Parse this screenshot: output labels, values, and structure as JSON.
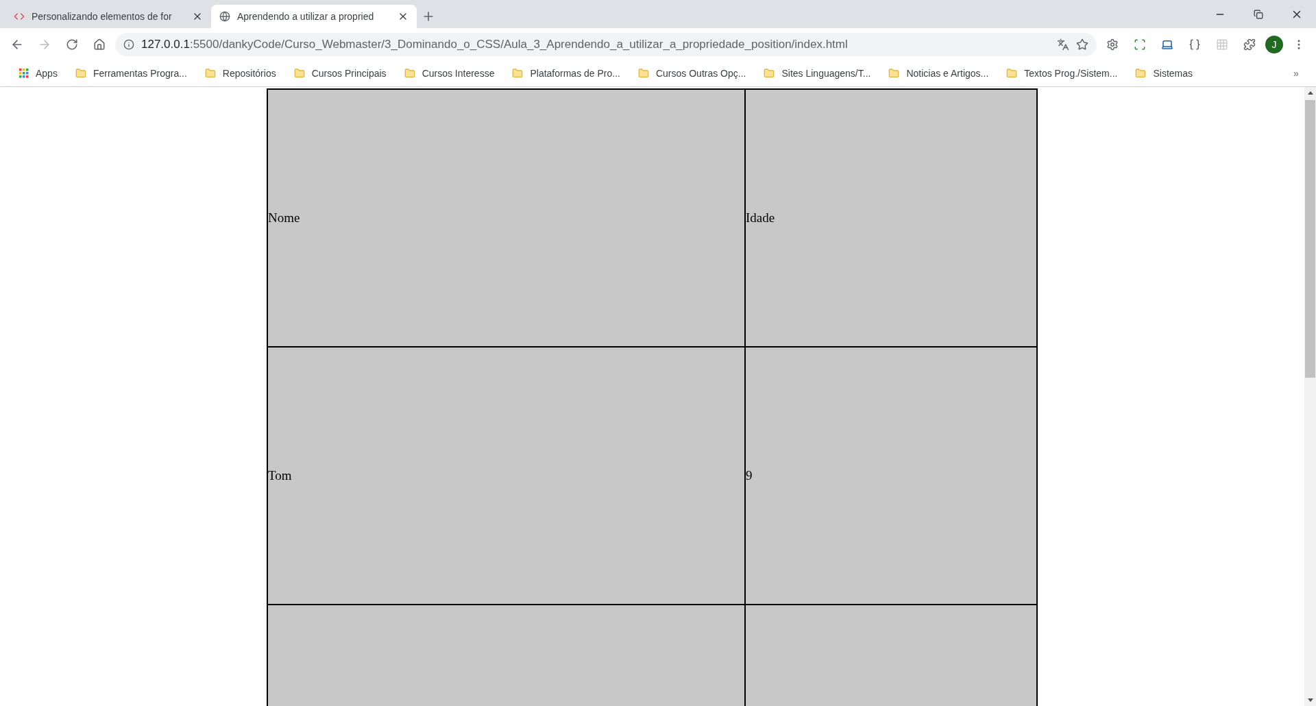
{
  "tabs": [
    {
      "title": "Personalizando elementos de for",
      "selected": false
    },
    {
      "title": "Aprendendo a utilizar a propried",
      "selected": true
    }
  ],
  "address": {
    "host": "127.0.0.1",
    "path": ":5500/dankyCode/Curso_Webmaster/3_Dominando_o_CSS/Aula_3_Aprendendo_a_utilizar_a_propriedade_position/index.html"
  },
  "profile_initial": "J",
  "bookmarks": {
    "apps": "Apps",
    "items": [
      "Ferramentas Progra...",
      "Repositórios",
      "Cursos Principais",
      "Cursos Interesse",
      "Plataformas de Pro...",
      "Cursos Outras Opç...",
      "Sites Linguagens/T...",
      "Noticias e Artigos...",
      "Textos Prog./Sistem...",
      "Sistemas"
    ],
    "more": "»"
  },
  "table": {
    "rows": [
      [
        "Nome",
        "Idade"
      ],
      [
        "Tom",
        "9"
      ]
    ]
  }
}
